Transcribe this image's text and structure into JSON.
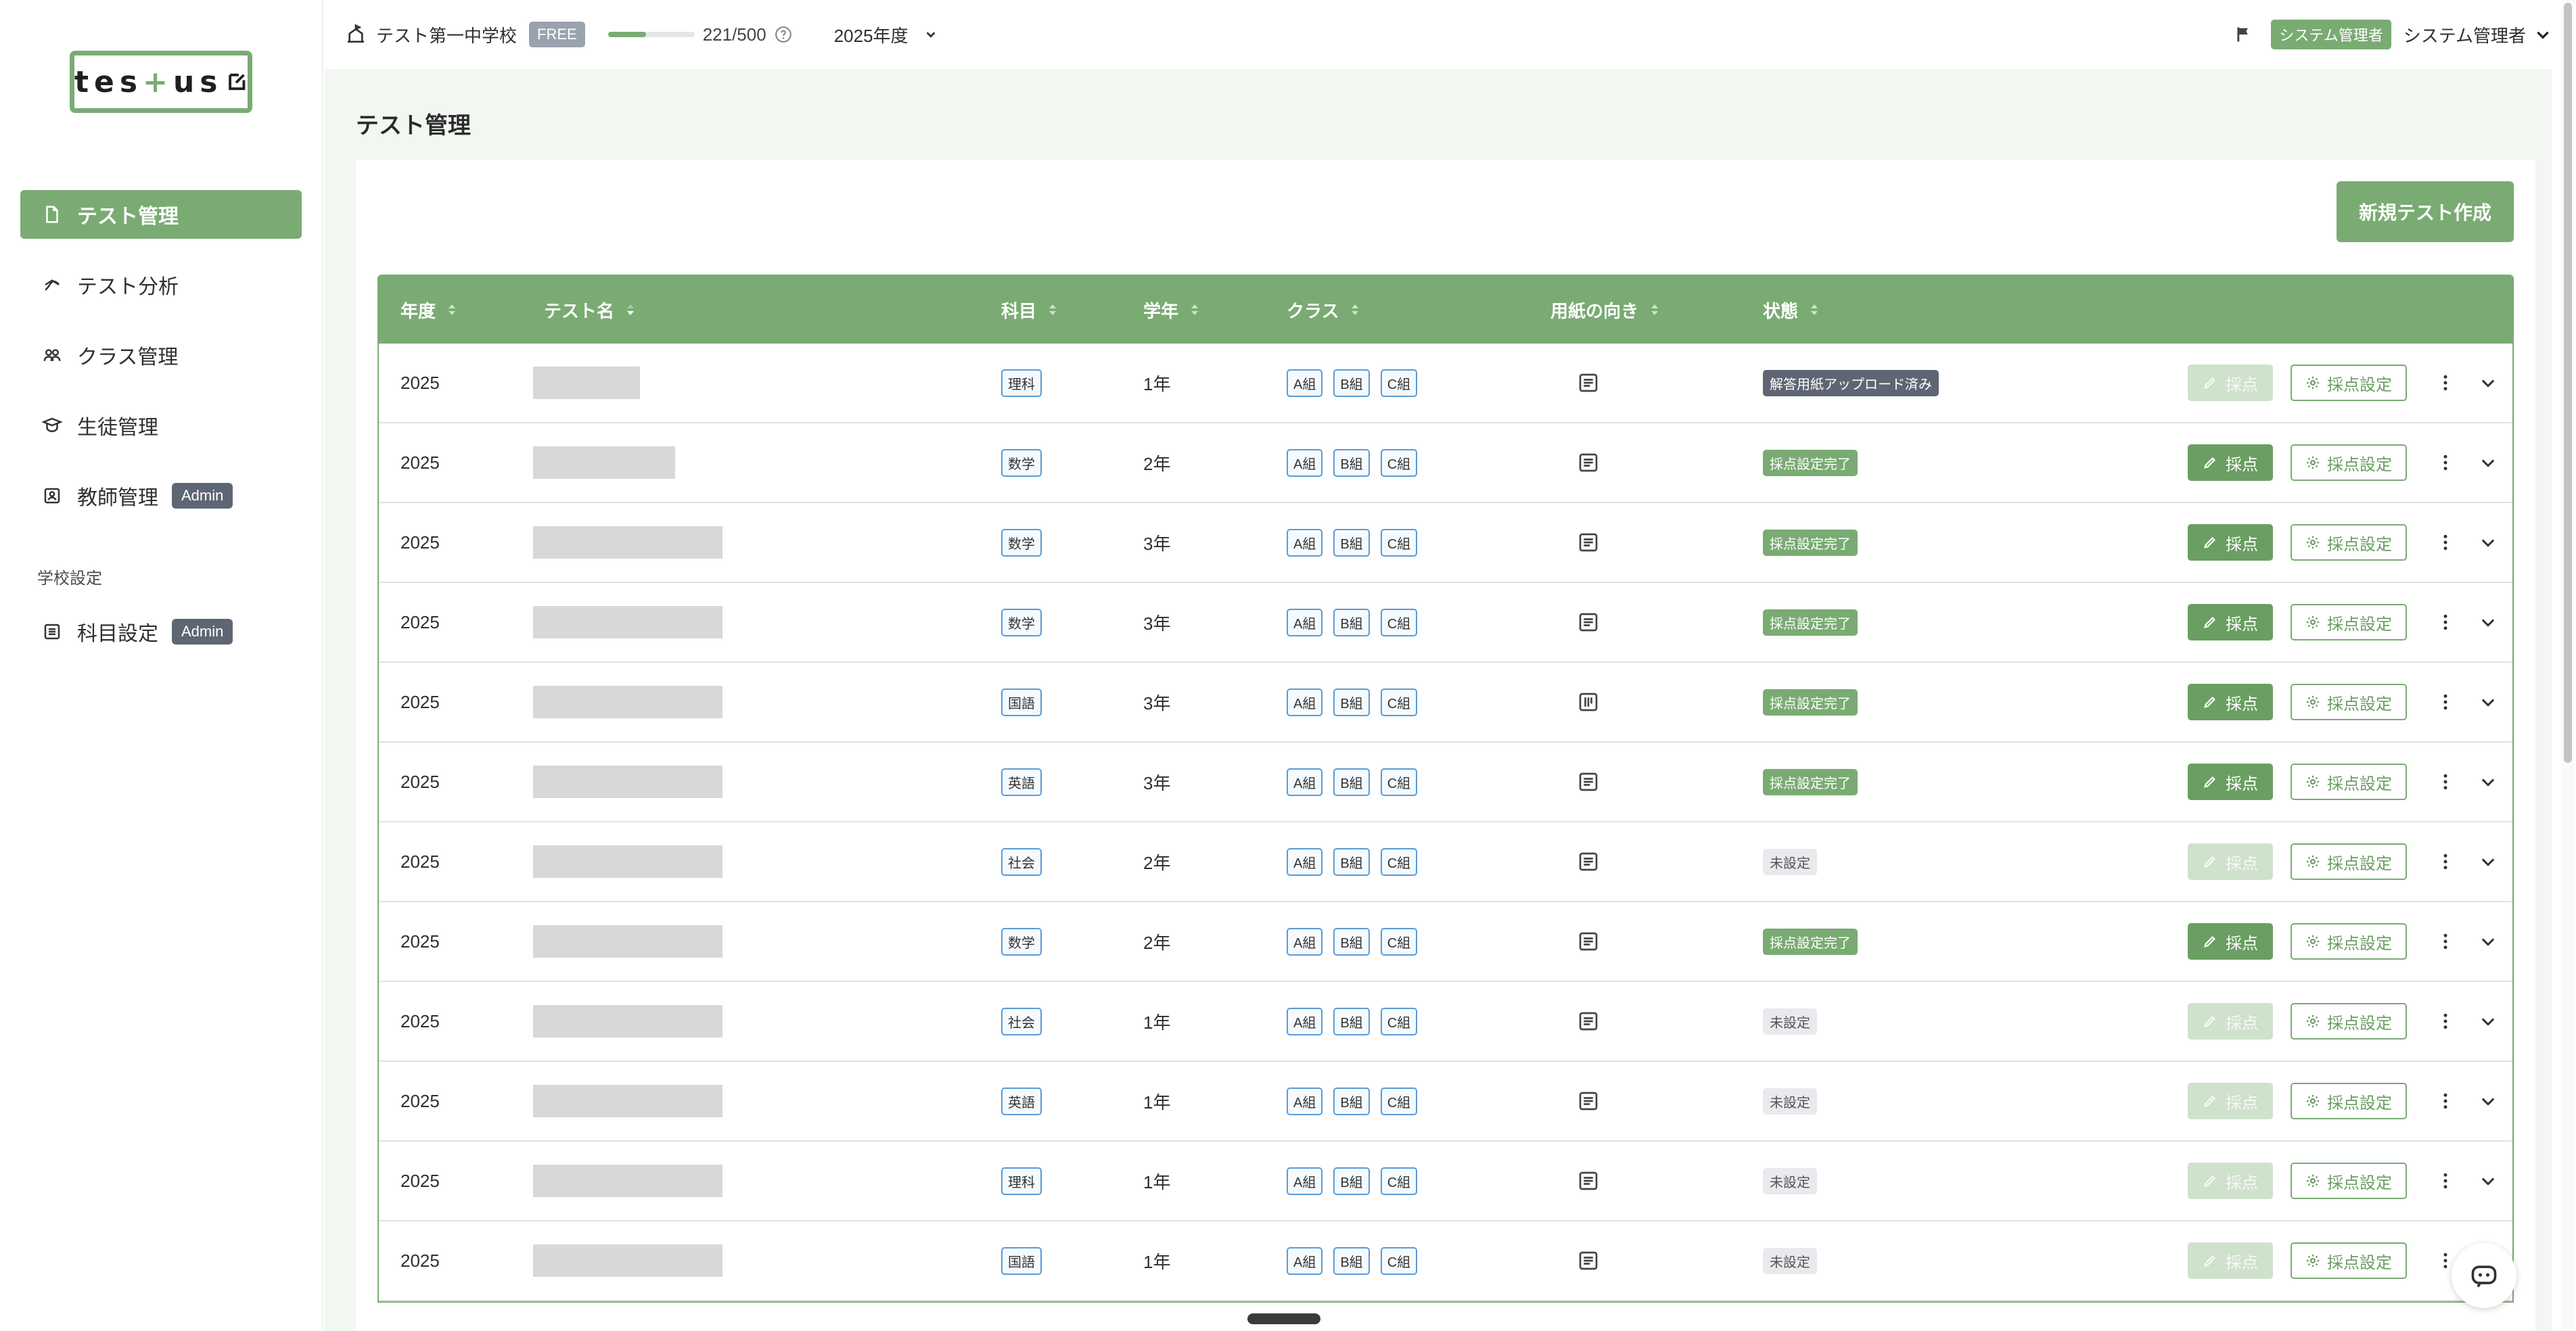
{
  "logo": {
    "part1": "tes",
    "plus": "+",
    "part2": "us"
  },
  "sidebar": {
    "items": [
      {
        "label": "テスト管理",
        "icon": "document-icon",
        "active": true
      },
      {
        "label": "テスト分析",
        "icon": "analysis-icon",
        "active": false
      },
      {
        "label": "クラス管理",
        "icon": "class-icon",
        "active": false
      },
      {
        "label": "生徒管理",
        "icon": "student-icon",
        "active": false
      },
      {
        "label": "教師管理",
        "icon": "teacher-icon",
        "active": false,
        "badge": "Admin"
      }
    ],
    "section_label": "学校設定",
    "settings_items": [
      {
        "label": "科目設定",
        "icon": "list-icon",
        "badge": "Admin"
      }
    ]
  },
  "header": {
    "school_name": "テスト第一中学校",
    "plan_badge": "FREE",
    "usage_text": "221/500",
    "usage_fraction": 0.442,
    "year_label": "2025年度",
    "role_badge": "システム管理者",
    "user_name": "システム管理者"
  },
  "main": {
    "page_title": "テスト管理",
    "new_test_button": "新規テスト作成"
  },
  "table": {
    "headers": {
      "year": "年度",
      "name": "テスト名",
      "subject": "科目",
      "grade": "学年",
      "class": "クラス",
      "orientation": "用紙の向き",
      "status": "状態"
    },
    "grade_button": "採点",
    "settings_button": "採点設定",
    "rows": [
      {
        "year": "2025",
        "subject": "理科",
        "grade": "1年",
        "classes": [
          "A組",
          "B組",
          "C組"
        ],
        "orientation": "landscape",
        "status": "解答用紙アップロード済み",
        "status_type": "uploaded",
        "grade_enabled": false,
        "name_width": 158
      },
      {
        "year": "2025",
        "subject": "数学",
        "grade": "2年",
        "classes": [
          "A組",
          "B組",
          "C組"
        ],
        "orientation": "landscape",
        "status": "採点設定完了",
        "status_type": "done",
        "grade_enabled": true,
        "name_width": 210
      },
      {
        "year": "2025",
        "subject": "数学",
        "grade": "3年",
        "classes": [
          "A組",
          "B組",
          "C組"
        ],
        "orientation": "landscape",
        "status": "採点設定完了",
        "status_type": "done",
        "grade_enabled": true,
        "name_width": 280
      },
      {
        "year": "2025",
        "subject": "数学",
        "grade": "3年",
        "classes": [
          "A組",
          "B組",
          "C組"
        ],
        "orientation": "landscape",
        "status": "採点設定完了",
        "status_type": "done",
        "grade_enabled": true,
        "name_width": 280
      },
      {
        "year": "2025",
        "subject": "国語",
        "grade": "3年",
        "classes": [
          "A組",
          "B組",
          "C組"
        ],
        "orientation": "portrait",
        "status": "採点設定完了",
        "status_type": "done",
        "grade_enabled": true,
        "name_width": 280
      },
      {
        "year": "2025",
        "subject": "英語",
        "grade": "3年",
        "classes": [
          "A組",
          "B組",
          "C組"
        ],
        "orientation": "landscape",
        "status": "採点設定完了",
        "status_type": "done",
        "grade_enabled": true,
        "name_width": 280
      },
      {
        "year": "2025",
        "subject": "社会",
        "grade": "2年",
        "classes": [
          "A組",
          "B組",
          "C組"
        ],
        "orientation": "landscape",
        "status": "未設定",
        "status_type": "none",
        "grade_enabled": false,
        "name_width": 280
      },
      {
        "year": "2025",
        "subject": "数学",
        "grade": "2年",
        "classes": [
          "A組",
          "B組",
          "C組"
        ],
        "orientation": "landscape",
        "status": "採点設定完了",
        "status_type": "done",
        "grade_enabled": true,
        "name_width": 280
      },
      {
        "year": "2025",
        "subject": "社会",
        "grade": "1年",
        "classes": [
          "A組",
          "B組",
          "C組"
        ],
        "orientation": "landscape",
        "status": "未設定",
        "status_type": "none",
        "grade_enabled": false,
        "name_width": 280
      },
      {
        "year": "2025",
        "subject": "英語",
        "grade": "1年",
        "classes": [
          "A組",
          "B組",
          "C組"
        ],
        "orientation": "landscape",
        "status": "未設定",
        "status_type": "none",
        "grade_enabled": false,
        "name_width": 280
      },
      {
        "year": "2025",
        "subject": "理科",
        "grade": "1年",
        "classes": [
          "A組",
          "B組",
          "C組"
        ],
        "orientation": "landscape",
        "status": "未設定",
        "status_type": "none",
        "grade_enabled": false,
        "name_width": 280
      },
      {
        "year": "2025",
        "subject": "国語",
        "grade": "1年",
        "classes": [
          "A組",
          "B組",
          "C組"
        ],
        "orientation": "landscape",
        "status": "未設定",
        "status_type": "none",
        "grade_enabled": false,
        "name_width": 280
      }
    ]
  },
  "colors": {
    "brand": "#7aab73",
    "brand_dark": "#6a9e62",
    "tag_border": "#5a9bd5",
    "admin_badge": "#5f6673"
  }
}
